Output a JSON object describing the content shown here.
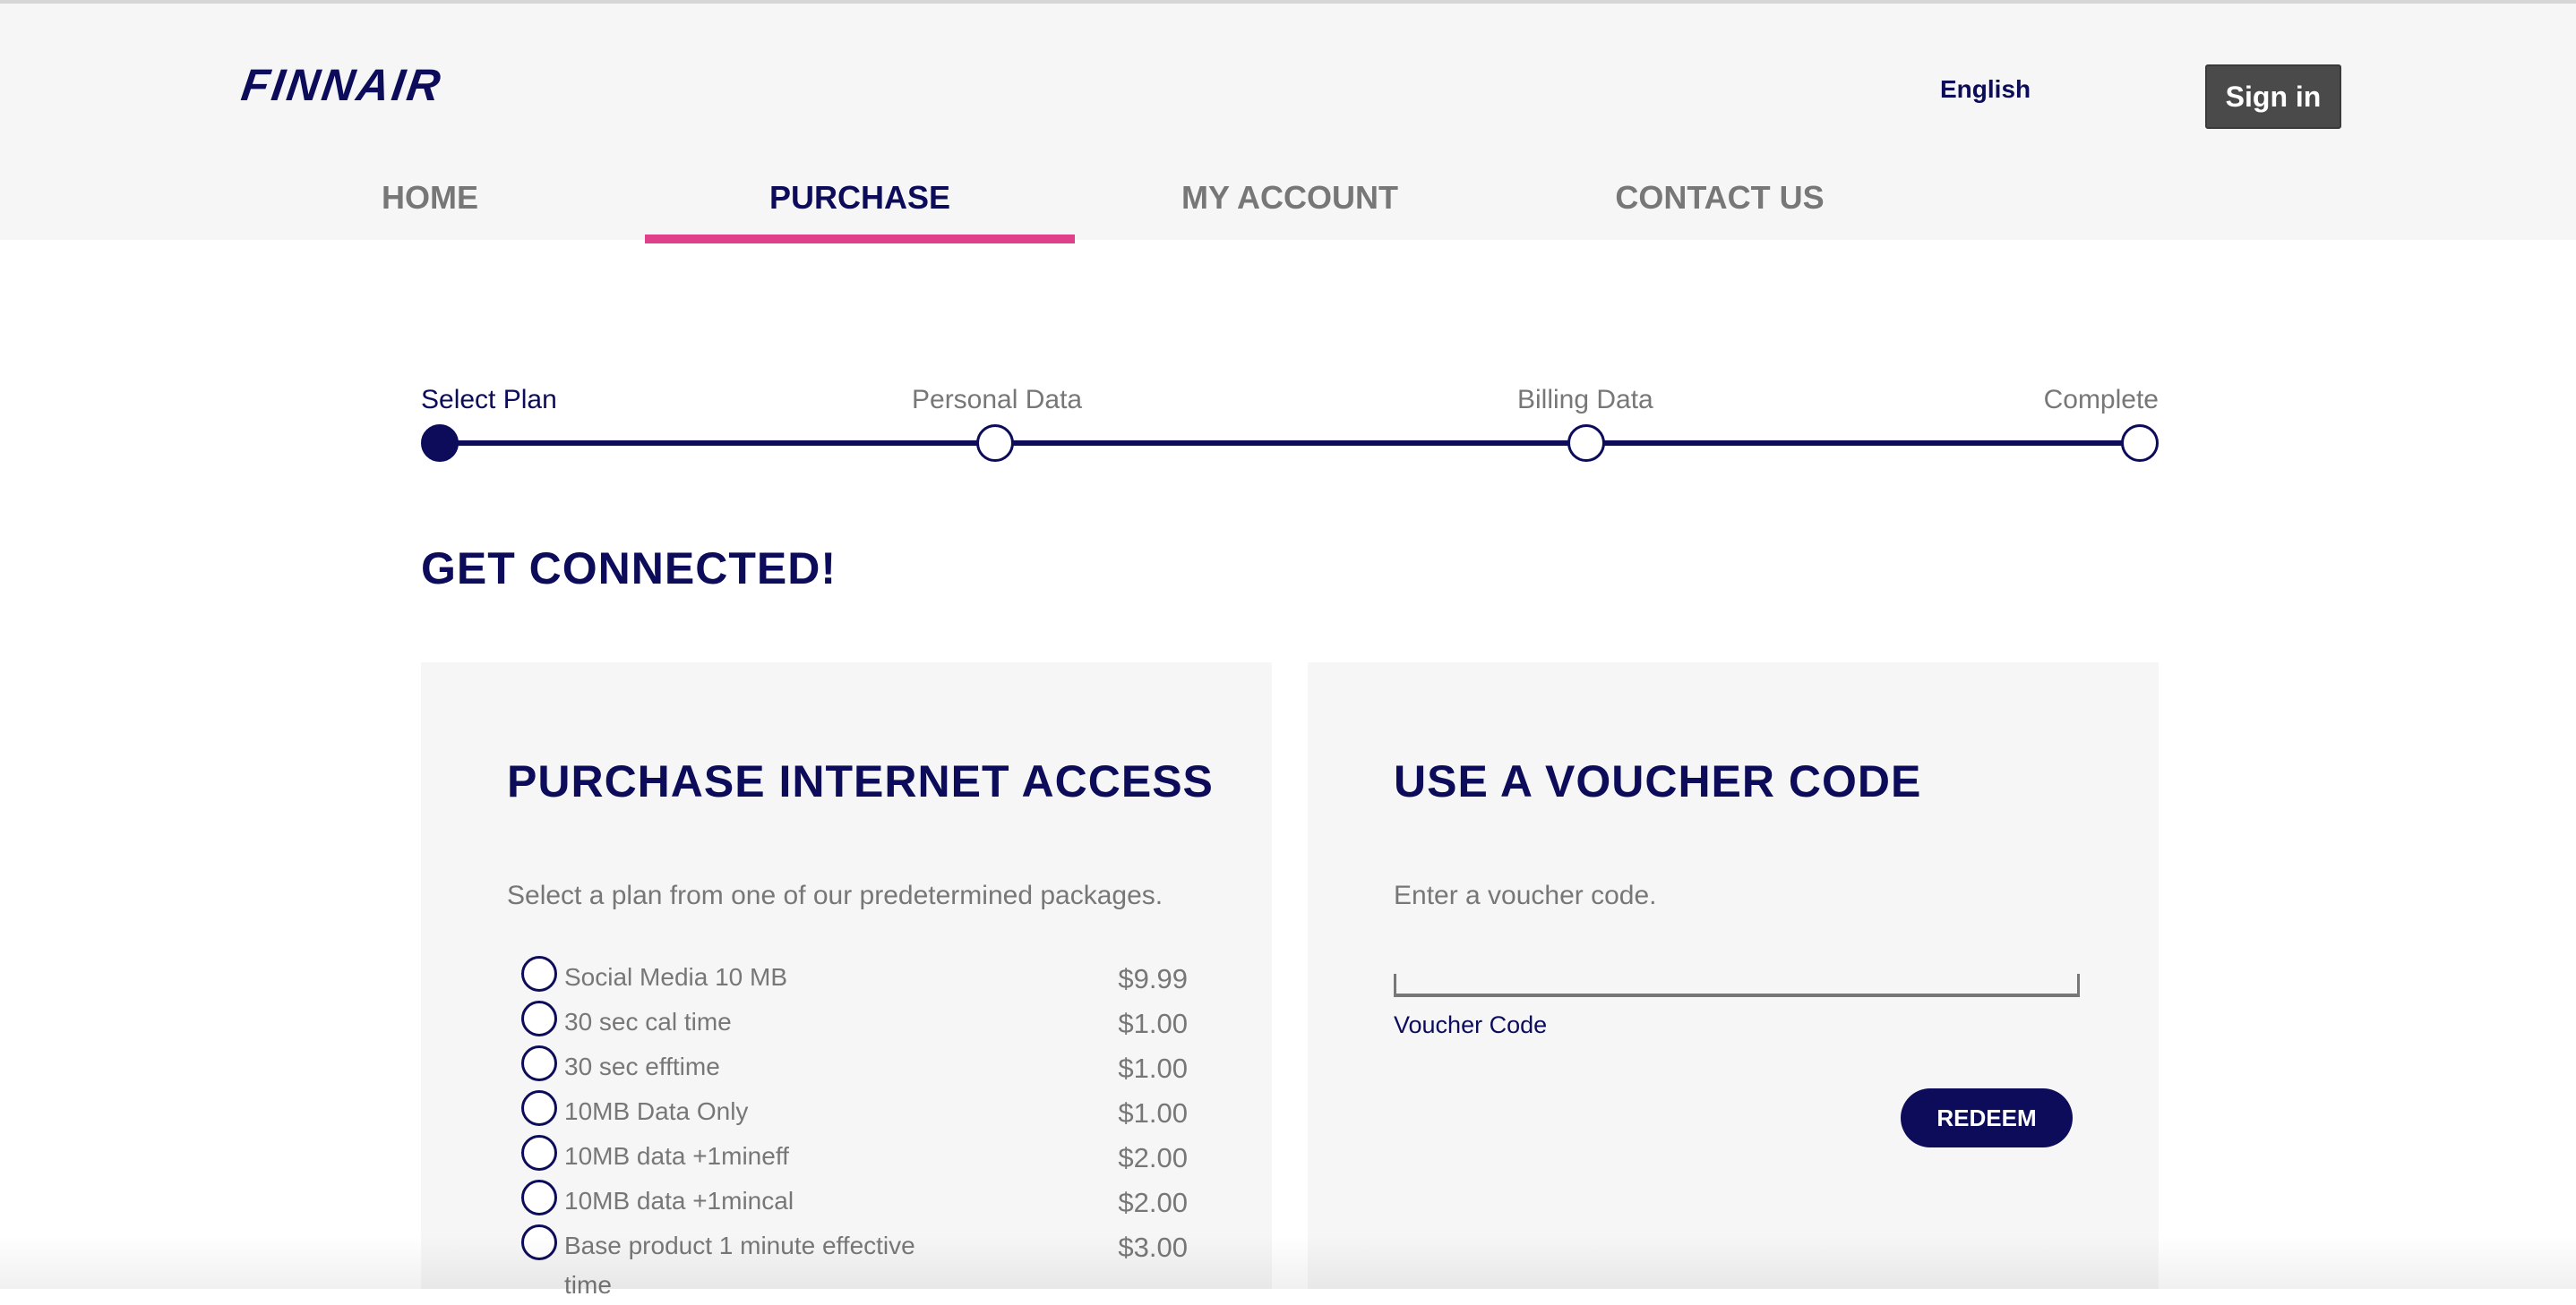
{
  "header": {
    "brand": "FINNAIR",
    "language": "English",
    "signin_label": "Sign in"
  },
  "nav": {
    "items": [
      {
        "label": "HOME",
        "active": false
      },
      {
        "label": "PURCHASE",
        "active": true
      },
      {
        "label": "MY ACCOUNT",
        "active": false
      },
      {
        "label": "CONTACT US",
        "active": false
      }
    ]
  },
  "stepper": {
    "steps": [
      {
        "label": "Select Plan",
        "current": true
      },
      {
        "label": "Personal Data",
        "current": false
      },
      {
        "label": "Billing Data",
        "current": false
      },
      {
        "label": "Complete",
        "current": false
      }
    ]
  },
  "main": {
    "heading": "GET CONNECTED!"
  },
  "purchase": {
    "title": "PURCHASE INTERNET ACCESS",
    "description": "Select a plan from one of our predetermined packages.",
    "plans": [
      {
        "name": "Social Media 10 MB",
        "price": "$9.99"
      },
      {
        "name": "30 sec cal time",
        "price": "$1.00"
      },
      {
        "name": "30 sec efftime",
        "price": "$1.00"
      },
      {
        "name": "10MB Data Only",
        "price": "$1.00"
      },
      {
        "name": "10MB data +1mineff",
        "price": "$2.00"
      },
      {
        "name": "10MB data +1mincal",
        "price": "$2.00"
      },
      {
        "name": "Base product 1 minute effective time",
        "price": "$3.00"
      }
    ]
  },
  "voucher": {
    "title": "USE A VOUCHER CODE",
    "description": "Enter a voucher code.",
    "input_value": "",
    "field_label": "Voucher Code",
    "redeem_label": "REDEEM"
  },
  "colors": {
    "brand_navy": "#0c0c5a",
    "accent_pink": "#e0408a",
    "header_bg": "#f6f6f6",
    "signin_bg": "#4a4a4a"
  }
}
